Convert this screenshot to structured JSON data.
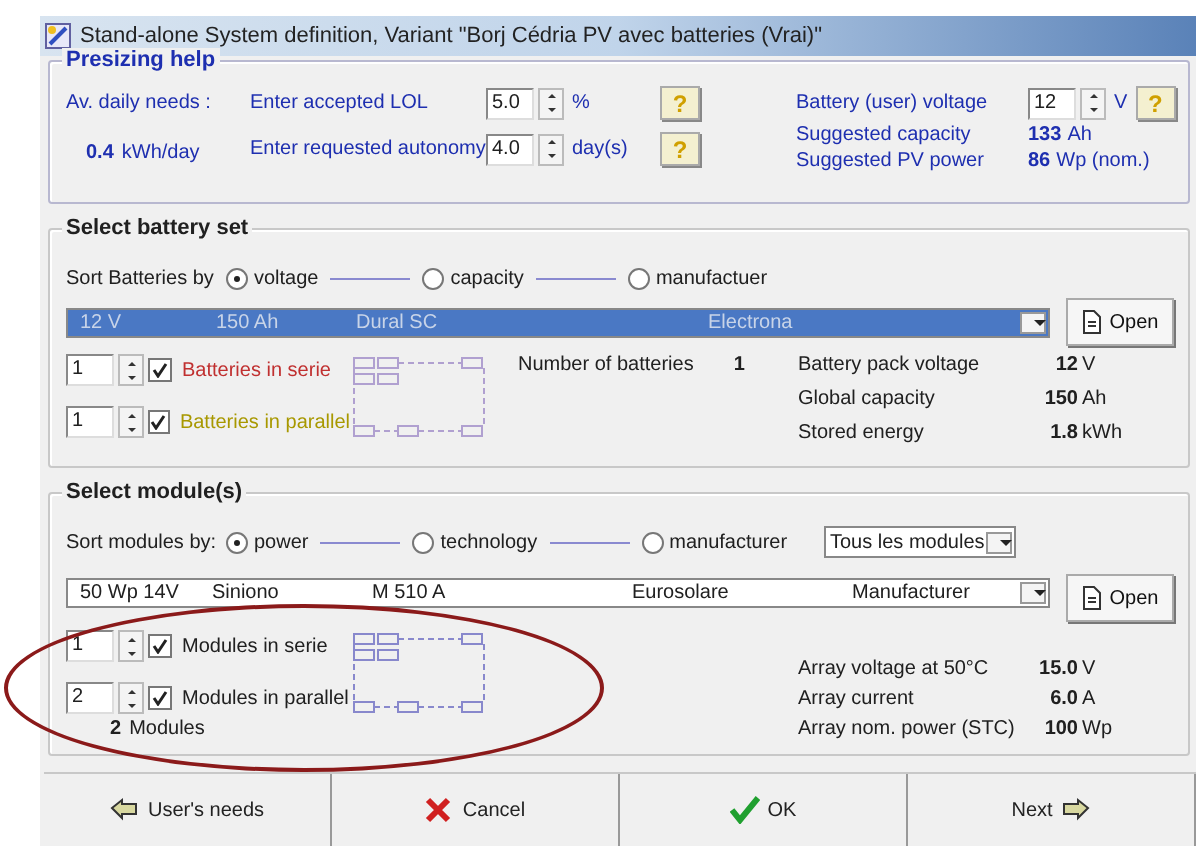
{
  "window": {
    "title": "Stand-alone System definition, Variant  \"Borj Cédria PV avec batteries (Vrai)\""
  },
  "presizing": {
    "title": "Presizing help",
    "daily_needs_label": "Av. daily needs :",
    "daily_needs_value": "0.4",
    "daily_needs_unit": "kWh/day",
    "inputs": [
      {
        "label": "Enter accepted LOL",
        "value": "5.0",
        "unit": "%",
        "help": "?"
      },
      {
        "label": "Enter requested autonomy",
        "value": "4.0",
        "unit": "day(s)",
        "help": "?"
      }
    ],
    "voltage": {
      "label": "Battery (user) voltage",
      "value": "12",
      "unit": "V",
      "help": "?"
    },
    "suggestions": [
      {
        "label": "Suggested capacity",
        "value": "133",
        "unit": "Ah"
      },
      {
        "label": "Suggested PV power",
        "value": "86",
        "unit": "Wp (nom.)"
      }
    ]
  },
  "battery_set": {
    "title": "Select battery set",
    "sort_label": "Sort Batteries by",
    "sort_options": [
      {
        "label": "voltage",
        "selected": true
      },
      {
        "label": "capacity",
        "selected": false
      },
      {
        "label": "manufactuer",
        "selected": false
      }
    ],
    "selection": {
      "columns": [
        "12 V",
        "150 Ah",
        "Dural SC",
        "Electrona"
      ],
      "highlighted": true
    },
    "open_button": "Open",
    "counts": [
      {
        "value": "1",
        "checked": true,
        "label": "Batteries in serie",
        "color": "#c03030"
      },
      {
        "value": "1",
        "checked": true,
        "label": "Batteries in parallel",
        "color": "#a89800"
      }
    ],
    "total": {
      "label": "Number of batteries",
      "value": "1"
    },
    "results": [
      {
        "label": "Battery pack voltage",
        "value": "12",
        "unit": "V"
      },
      {
        "label": "Global capacity",
        "value": "150",
        "unit": "Ah"
      },
      {
        "label": "Stored energy",
        "value": "1.8",
        "unit": "kWh"
      }
    ]
  },
  "modules": {
    "title": "Select module(s)",
    "sort_label": "Sort modules by:",
    "sort_options": [
      {
        "label": "power",
        "selected": true
      },
      {
        "label": "technology",
        "selected": false
      },
      {
        "label": "manufacturer",
        "selected": false
      }
    ],
    "filter": "Tous les modules",
    "selection": {
      "columns": [
        "50 Wp 14V",
        "Siniono",
        "M 510 A",
        "Eurosolare",
        "Manufacturer"
      ],
      "highlighted": false
    },
    "open_button": "Open",
    "counts": [
      {
        "value": "1",
        "checked": true,
        "label": "Modules in serie",
        "color": "#202020"
      },
      {
        "value": "2",
        "checked": true,
        "label": "Modules in parallel",
        "color": "#202020"
      }
    ],
    "total": {
      "value": "2",
      "label": "Modules"
    },
    "results": [
      {
        "label": "Array voltage at 50°C",
        "value": "15.0",
        "unit": "V"
      },
      {
        "label": "Array current",
        "value": "6.0",
        "unit": "A"
      },
      {
        "label": "Array nom. power (STC)",
        "value": "100",
        "unit": "Wp"
      }
    ]
  },
  "annotation": {
    "kind": "ellipse"
  },
  "buttons": [
    {
      "label": "User's needs",
      "kind": "back"
    },
    {
      "label": "Cancel",
      "kind": "cancel"
    },
    {
      "label": "OK",
      "kind": "ok"
    },
    {
      "label": "Next",
      "kind": "next"
    }
  ]
}
